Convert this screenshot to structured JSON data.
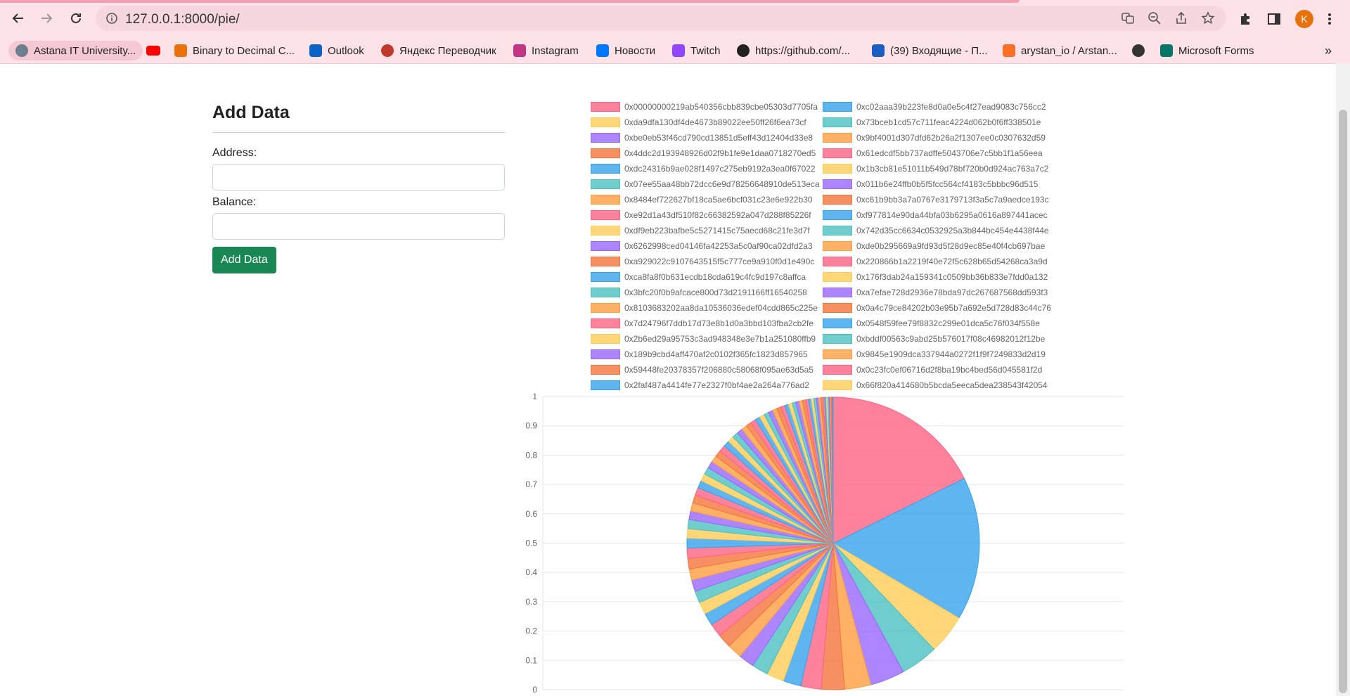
{
  "browser": {
    "url": "127.0.0.1:8000/pie/",
    "profile_initial": "K",
    "bookmarks": [
      {
        "label": "Astana IT University...",
        "icon": "university-icon",
        "color": "#6b7f8f"
      },
      {
        "label": "",
        "icon": "youtube-icon",
        "color": "#ff0000"
      },
      {
        "label": "Binary to Decimal C...",
        "icon": "r-logo-icon",
        "color": "#e8710a"
      },
      {
        "label": "Outlook",
        "icon": "outlook-icon",
        "color": "#0a64c8"
      },
      {
        "label": "Яндекс Переводчик",
        "icon": "translate-icon",
        "color": "#c0392b"
      },
      {
        "label": "Instagram",
        "icon": "instagram-icon",
        "color": "#c13584"
      },
      {
        "label": "Новости",
        "icon": "vk-icon",
        "color": "#0077ff"
      },
      {
        "label": "Twitch",
        "icon": "twitch-icon",
        "color": "#9146ff"
      },
      {
        "label": "https://github.com/...",
        "icon": "github-icon",
        "color": "#222222"
      },
      {
        "label": "(39) Входящие - П...",
        "icon": "mail-icon",
        "color": "#1c5fc4"
      },
      {
        "label": "arystan_io / Arstan...",
        "icon": "gitlab-icon",
        "color": "#fc6d26"
      },
      {
        "label": "",
        "icon": "globe-icon",
        "color": "#333333"
      },
      {
        "label": "Microsoft Forms",
        "icon": "forms-icon",
        "color": "#077568"
      }
    ]
  },
  "form": {
    "title": "Add Data",
    "address_label": "Address:",
    "address_value": "",
    "balance_label": "Balance:",
    "balance_value": "",
    "submit_label": "Add Data"
  },
  "chart_data": {
    "type": "pie",
    "palette": [
      "#ff6384",
      "#36a2eb",
      "#ffcd56",
      "#4bc0c0",
      "#9966ff",
      "#ff9f40",
      "#f4743b"
    ],
    "y_ticks": [
      "1",
      "0.9",
      "0.8",
      "0.7",
      "0.6",
      "0.5",
      "0.4",
      "0.3",
      "0.2",
      "0.1",
      "0"
    ],
    "legend": [
      "0x00000000219ab540356cbb839cbe05303d7705fa",
      "0xc02aaa39b223fe8d0a0e5c4f27ead9083c756cc2",
      "0xda9dfa130df4de4673b89022ee50ff26f6ea73cf",
      "0x73bceb1cd57c711feac4224d062b0f6ff338501e",
      "0xbe0eb53f46cd790cd13851d5eff43d12404d33e8",
      "0x9bf4001d307dfd62b26a2f1307ee0c0307632d59",
      "0x4ddc2d193948926d02f9b1fe9e1daa0718270ed5",
      "0x61edcdf5bb737adffe5043706e7c5bb1f1a56eea",
      "0xdc24316b9ae028f1497c275eb9192a3ea0f67022",
      "0x1b3cb81e51011b549d78bf720b0d924ac763a7c2",
      "0x07ee55aa48bb72dcc6e9d78256648910de513eca",
      "0x011b6e24ffb0b5f5fcc564cf4183c5bbbc96d515",
      "0x8484ef722627bf18ca5ae6bcf031c23e6e922b30",
      "0xc61b9bb3a7a0767e3179713f3a5c7a9aedce193c",
      "0xe92d1a43df510f82c66382592a047d288f85226f",
      "0xf977814e90da44bfa03b6295a0616a897441acec",
      "0xdf9eb223bafbe5c5271415c75aecd68c21fe3d7f",
      "0x742d35cc6634c0532925a3b844bc454e4438f44e",
      "0x6262998ced04146fa42253a5c0af90ca02dfd2a3",
      "0xde0b295669a9fd93d5f28d9ec85e40f4cb697bae",
      "0xa929022c9107643515f5c777ce9a910f0d1e490c",
      "0x220866b1a2219f40e72f5c628b65d54268ca3a9d",
      "0xca8fa8f0b631ecdb18cda619c4fc9d197c8affca",
      "0x176f3dab24a159341c0509bb36b833e7fdd0a132",
      "0x3bfc20f0b9afcace800d73d2191166ff16540258",
      "0xa7efae728d2936e78bda97dc267687568dd593f3",
      "0x8103683202aa8da10536036edef04cdd865c225e",
      "0x0a4c79ce84202b03e95b7a692e5d728d83c44c76",
      "0x7d24796f7ddb17d73e8b1d0a3bbd103fba2cb2fe",
      "0x0548f59fee79f8832c299e01dca5c76f034f558e",
      "0x2b6ed29a95753c3ad948348e3e7b1a251080ffb9",
      "0xbddf00563c9abd25b576017f08c46982012f12be",
      "0x189b9cbd4aff470af2c0102f365fc1823d857965",
      "0x9845e1909dca337944a0272f1f9f7249833d2d19",
      "0x59448fe20378357f206880c58068f095ae63d5a5",
      "0x0c23fc0ef06716d2f8ba19bc4bed56d045581f2d",
      "0x2faf487a4414fe77e2327f0bf4ae2a264a776ad2",
      "0x66f820a414680b5bcda5eeca5dea238543f42054"
    ],
    "values": [
      19.5,
      17.5,
      4.8,
      4.6,
      4.2,
      3.2,
      2.8,
      2.5,
      2.2,
      2.1,
      2.0,
      1.9,
      1.8,
      1.7,
      1.6,
      1.55,
      1.5,
      1.45,
      1.4,
      1.35,
      1.3,
      1.25,
      1.2,
      1.15,
      1.1,
      1.05,
      1.0,
      0.98,
      0.95,
      0.92,
      0.9,
      0.88,
      0.85,
      0.82,
      0.8,
      0.78,
      0.76,
      0.74,
      0.72,
      0.7,
      0.68,
      0.66,
      0.64,
      0.62,
      0.6,
      0.58,
      0.56,
      0.54,
      0.52,
      0.5,
      0.48,
      0.46,
      0.44,
      0.42,
      0.4,
      0.38,
      0.36,
      0.34,
      0.32,
      0.3,
      0.28,
      0.26,
      0.24,
      0.22,
      0.2,
      0.18,
      0.16,
      0.14,
      0.12,
      0.1,
      0.08,
      0.06
    ]
  }
}
